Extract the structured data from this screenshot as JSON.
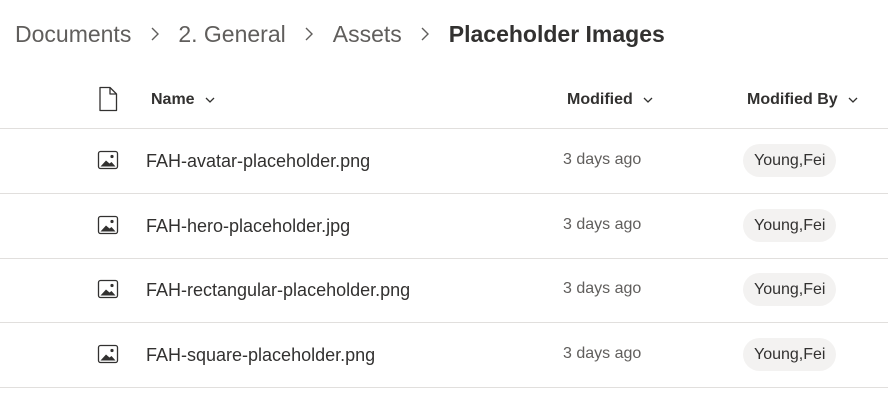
{
  "breadcrumb": {
    "items": [
      "Documents",
      "2. General",
      "Assets",
      "Placeholder Images"
    ]
  },
  "columns": {
    "type_icon": "file-icon",
    "name": "Name",
    "modified": "Modified",
    "modified_by": "Modified By"
  },
  "files": [
    {
      "icon": "image-file-icon",
      "name": "FAH-avatar-placeholder.png",
      "modified": "3 days ago",
      "modified_by": "Young,Fei"
    },
    {
      "icon": "image-file-icon",
      "name": "FAH-hero-placeholder.jpg",
      "modified": "3 days ago",
      "modified_by": "Young,Fei"
    },
    {
      "icon": "image-file-icon",
      "name": "FAH-rectangular-placeholder.png",
      "modified": "3 days ago",
      "modified_by": "Young,Fei"
    },
    {
      "icon": "image-file-icon",
      "name": "FAH-square-placeholder.png",
      "modified": "3 days ago",
      "modified_by": "Young,Fei"
    }
  ],
  "colors": {
    "text": "#323130",
    "secondary_text": "#605e5c",
    "divider": "#e1dfdd",
    "persona_bg": "#f3f2f1"
  }
}
